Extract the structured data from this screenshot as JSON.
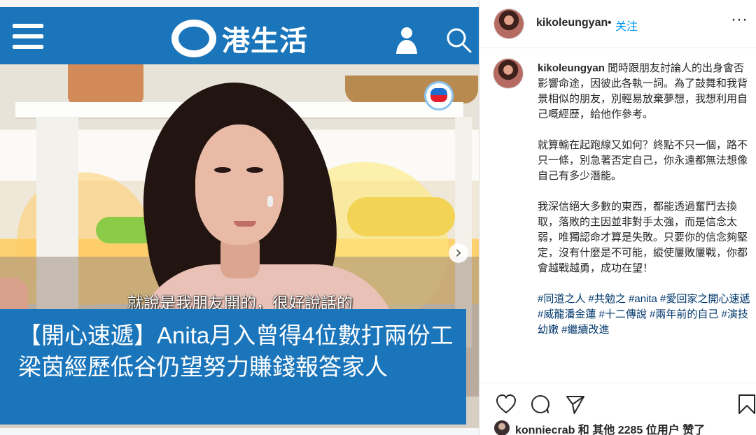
{
  "site": {
    "name": "港生活",
    "tv_badge": "TVB"
  },
  "hero": {
    "subtitle": "就說是我朋友開的，很好說話的",
    "headline": "【開心速遞】Anita月入曾得4位數打兩份工 梁茵經歷低谷仍望努力賺錢報答家人",
    "next_glyph": "›"
  },
  "instagram": {
    "username": "kikoleungyan",
    "follow_separator": "•",
    "follow_label": "关注",
    "more_glyph": "···",
    "caption_username": "kikoleungyan",
    "paragraph_1": "閒時跟朋友討論人的出身會否影響命途，因彼此各執一詞。為了鼓舞和我背景相似的朋友，別輕易放棄夢想，我想利用自己嘅經歷，給他作參考。",
    "paragraph_2": "就算輸在起跑線又如何？終點不只一個，路不只一條，別急著否定自己，你永遠都無法想像自己有多少潛能。",
    "paragraph_3": "我深信絕大多數的東西，都能透過奮鬥去換取，落敗的主因並非對手太強，而是信念太弱，唯獨認命才算是失敗。只要你的信念夠堅定，沒有什麼是不可能，縱使屢敗屢戰，你都會越戰越勇，成功在望！",
    "hashtags": "#同道之人 #共勉之 #anita #愛回家之開心速遞 #威龍潘金蓮 #十二傳說 #兩年前的自己 #演技幼嫩 #繼續改進",
    "likes_text": "konniecrab 和 其他 2285 位用户 赞了"
  },
  "colors": {
    "brand_blue": "#1b75bb",
    "headline_accent": "#ffd400",
    "instagram_link": "#0095f6",
    "instagram_hashtag": "#00376b"
  },
  "icons": {
    "menu": "hamburger-icon",
    "user": "user-icon",
    "search": "search-icon",
    "heart": "heart-icon",
    "comment": "comment-icon",
    "share": "paper-plane-icon",
    "save": "bookmark-icon"
  }
}
